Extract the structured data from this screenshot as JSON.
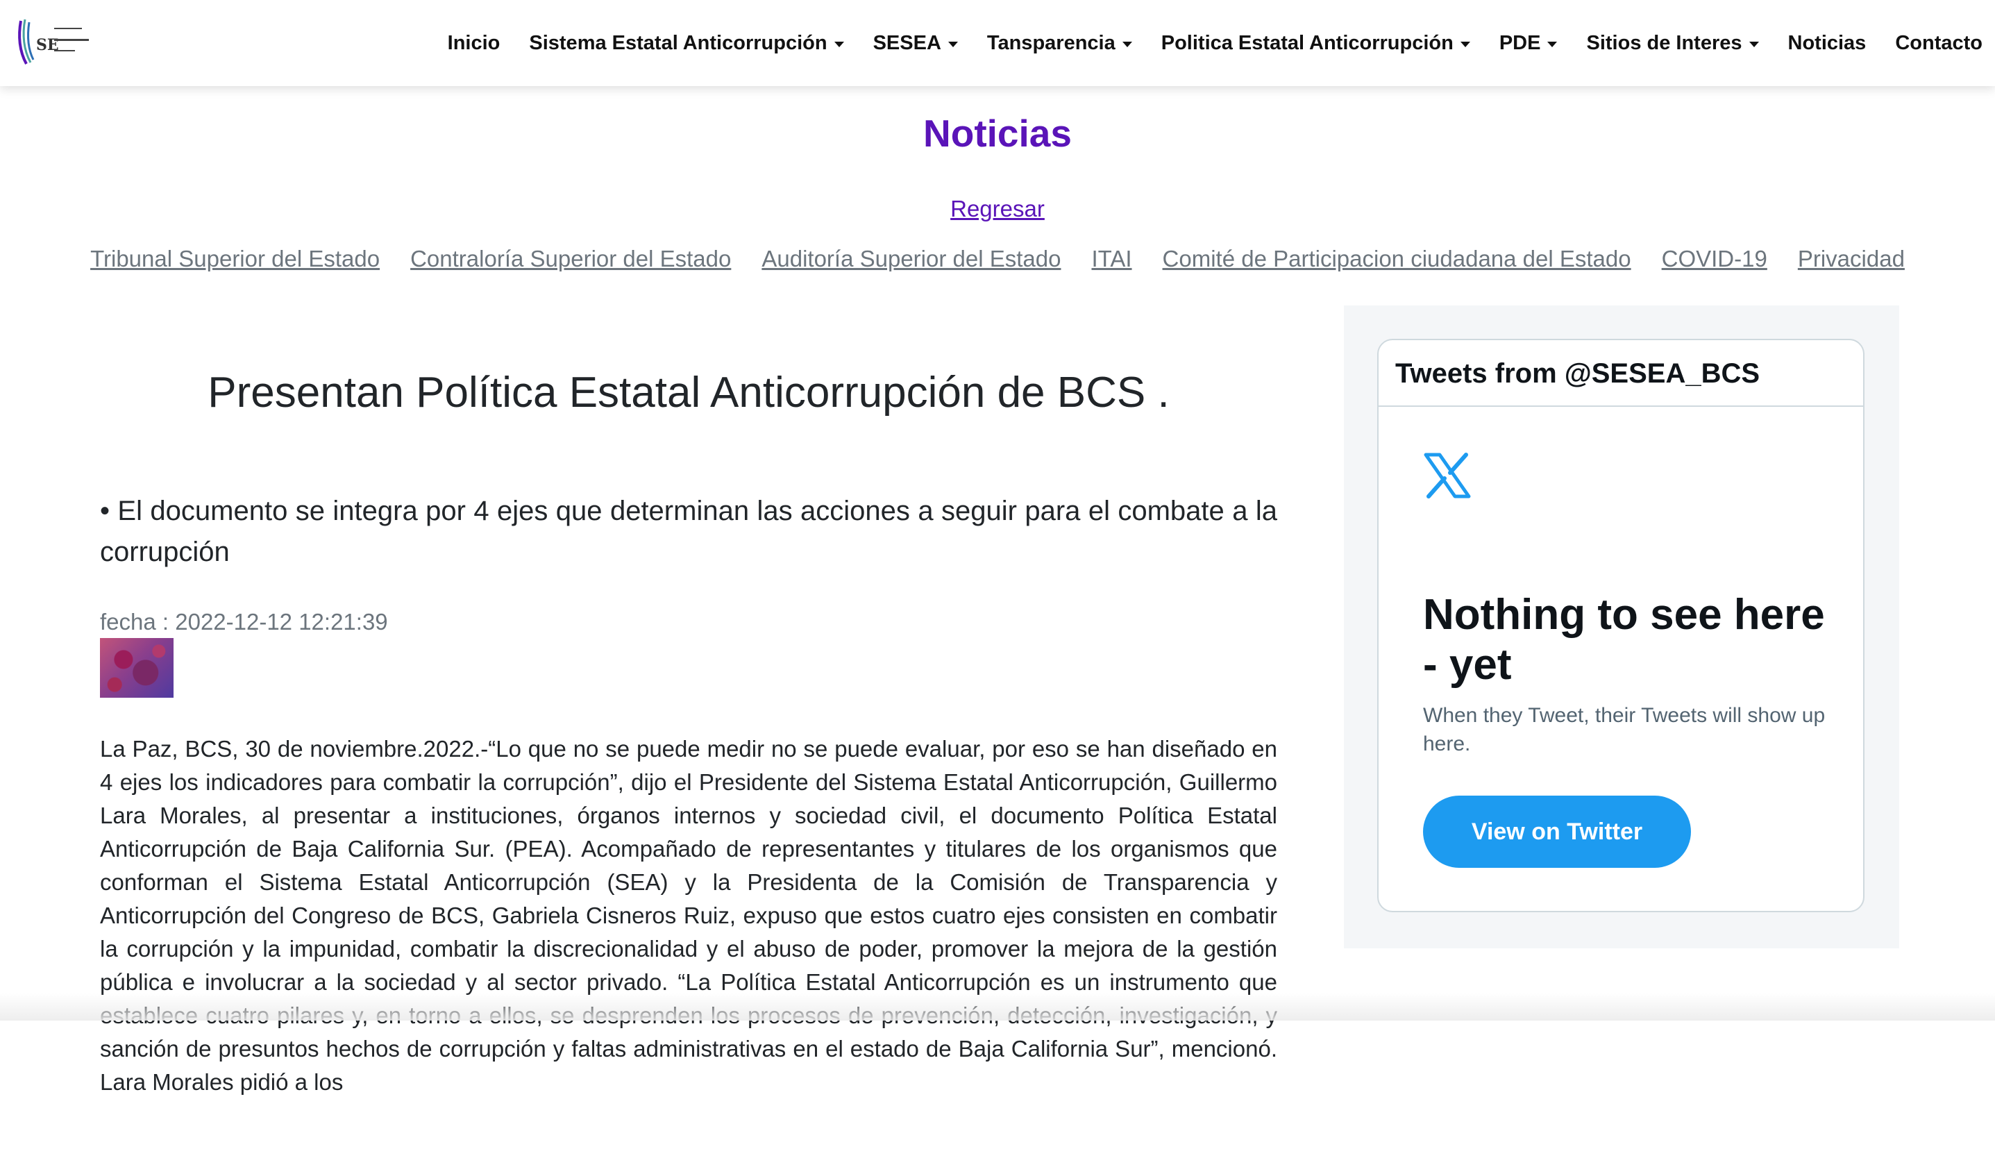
{
  "nav": {
    "logo_label": "SE",
    "items": [
      {
        "label": "Inicio",
        "dropdown": false
      },
      {
        "label": "Sistema Estatal Anticorrupción",
        "dropdown": true
      },
      {
        "label": "SESEA",
        "dropdown": true
      },
      {
        "label": "Tansparencia",
        "dropdown": true
      },
      {
        "label": "Politica Estatal Anticorrupción",
        "dropdown": true
      },
      {
        "label": "PDE",
        "dropdown": true
      },
      {
        "label": "Sitios de Interes",
        "dropdown": true
      },
      {
        "label": "Noticias",
        "dropdown": false
      },
      {
        "label": "Contacto",
        "dropdown": false
      }
    ]
  },
  "page": {
    "title": "Noticias",
    "back_label": "Regresar",
    "links": [
      "Tribunal Superior del Estado",
      "Contraloría Superior del Estado",
      "Auditoría Superior del Estado",
      "ITAI",
      "Comité de Participacion ciudadana del Estado",
      "COVID-19",
      "Privacidad"
    ]
  },
  "article": {
    "title": "Presentan Política Estatal Anticorrupción de BCS .",
    "lead": "• El documento se integra por 4 ejes que determinan las acciones a seguir para el combate a la corrupción",
    "date": "fecha : 2022-12-12 12:21:39",
    "body": "La Paz, BCS, 30 de noviembre.2022.-“Lo que no se puede medir no se puede evaluar, por eso se han diseñado en 4 ejes los indicadores para combatir la corrupción”, dijo el Presidente del Sistema Estatal Anticorrupción, Guillermo Lara Morales, al presentar a instituciones, órganos internos y sociedad civil, el documento Política Estatal Anticorrupción de Baja California Sur. (PEA). Acompañado de representantes y titulares de los organismos que conforman el Sistema Estatal Anticorrupción (SEA) y la Presidenta de la Comisión de Transparencia y Anticorrupción del Congreso de BCS, Gabriela Cisneros Ruiz, expuso que estos cuatro ejes consisten en combatir la corrupción y la impunidad, combatir la discrecionalidad y el abuso de poder, promover la mejora de la gestión pública e involucrar a la sociedad y al sector privado. “La Política Estatal Anticorrupción es un instrumento que establece cuatro pilares y, en torno a ellos, se desprenden los procesos de prevención, detección, investigación, y sanción de presuntos hechos de corrupción y faltas administrativas en el estado de Baja California Sur”, mencionó. Lara Morales pidió a los"
  },
  "twitter": {
    "header": "Tweets from @SESEA_BCS",
    "empty_title": "Nothing to see here - yet",
    "empty_text": "When they Tweet, their Tweets will show up here.",
    "button_label": "View on Twitter",
    "brand_color": "#1d9bf0"
  },
  "colors": {
    "accent": "#5a14b8",
    "link_muted": "#6c757d"
  }
}
